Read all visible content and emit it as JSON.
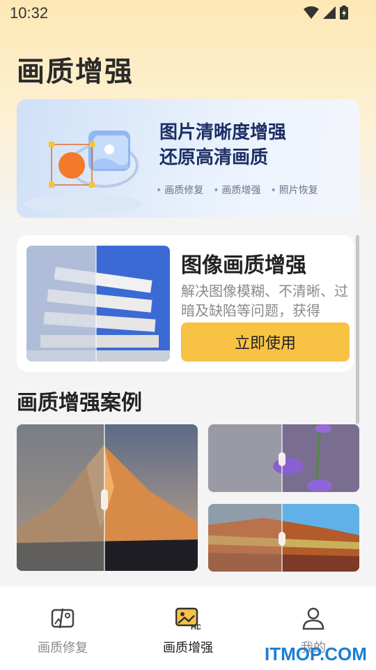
{
  "status_bar": {
    "time": "10:32"
  },
  "header": {
    "title": "画质增强"
  },
  "banner": {
    "title_line1": "图片清晰度增强",
    "title_line2": "还原高清画质",
    "tags": [
      "画质修复",
      "画质增强",
      "照片恢复"
    ]
  },
  "feature": {
    "title": "图像画质增强",
    "description": "解决图像模糊、不清晰、过暗及缺陷等问题，获得",
    "button_label": "立即使用"
  },
  "cases": {
    "title": "画质增强案例"
  },
  "nav": {
    "items": [
      {
        "label": "画质修复",
        "icon": "photo-restore-icon",
        "active": false
      },
      {
        "label": "画质增强",
        "icon": "hd-image-icon",
        "active": true
      },
      {
        "label": "我的",
        "icon": "user-icon",
        "active": false
      }
    ]
  },
  "watermark": "ITMOP.COM",
  "colors": {
    "accent": "#f8c245",
    "banner_title": "#1c2f66",
    "watermark": "#1a7fd6"
  }
}
